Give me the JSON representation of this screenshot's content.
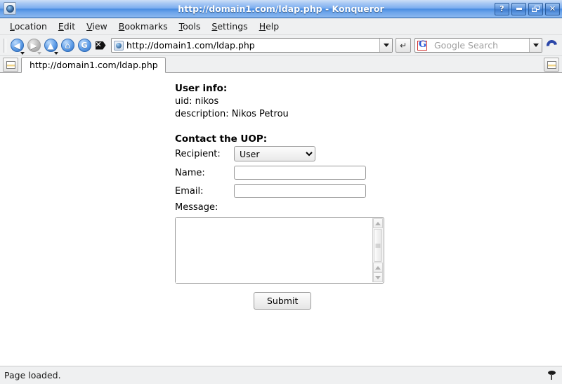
{
  "window": {
    "title": "http://domain1.com/ldap.php - Konqueror",
    "app_icon": "konqueror-icon",
    "buttons": {
      "help": "?",
      "minimize": "minimize",
      "restore": "restore",
      "close": "✕"
    }
  },
  "menubar": {
    "items": [
      {
        "label": "Location",
        "accel": "L"
      },
      {
        "label": "Edit",
        "accel": "E"
      },
      {
        "label": "View",
        "accel": "V"
      },
      {
        "label": "Bookmarks",
        "accel": "B"
      },
      {
        "label": "Tools",
        "accel": "T"
      },
      {
        "label": "Settings",
        "accel": "S"
      },
      {
        "label": "Help",
        "accel": "H"
      }
    ]
  },
  "toolbar": {
    "back": "◀",
    "forward": "▶",
    "up": "▲",
    "home": "⌂",
    "reload": "G",
    "stop": "stop",
    "url": {
      "value": "http://domain1.com/ldap.php",
      "favicon": "konqueror-globe-icon"
    },
    "go_label": "↵",
    "search": {
      "placeholder": "Google Search",
      "engine_icon": "google-g-icon",
      "engine_letter": "G"
    },
    "spinner": "konqueror-spinner-icon"
  },
  "tabbar": {
    "new_tab_icon": "new-tab-icon",
    "tabs": [
      {
        "label": "http://domain1.com/ldap.php",
        "favicon": "konqueror-globe-icon",
        "active": true
      }
    ],
    "right_button_icon": "tab-list-icon"
  },
  "page": {
    "user_info_heading": "User info:",
    "uid_line": "uid: nikos",
    "description_line": "description: Nikos Petrou",
    "contact_heading": "Contact the UOP:",
    "form": {
      "recipient_label": "Recipient:",
      "recipient_value": "User",
      "recipient_options": [
        "User"
      ],
      "name_label": "Name:",
      "name_value": "",
      "email_label": "Email:",
      "email_value": "",
      "message_label": "Message:",
      "message_value": "",
      "submit_label": "Submit"
    }
  },
  "statusbar": {
    "text": "Page loaded.",
    "icon": "pin-icon"
  },
  "colors": {
    "titlebar_blue": "#4a8de2",
    "chrome_grey": "#eff0f1",
    "page_background": "#ffffff",
    "border_grey": "#9a9a9a"
  }
}
